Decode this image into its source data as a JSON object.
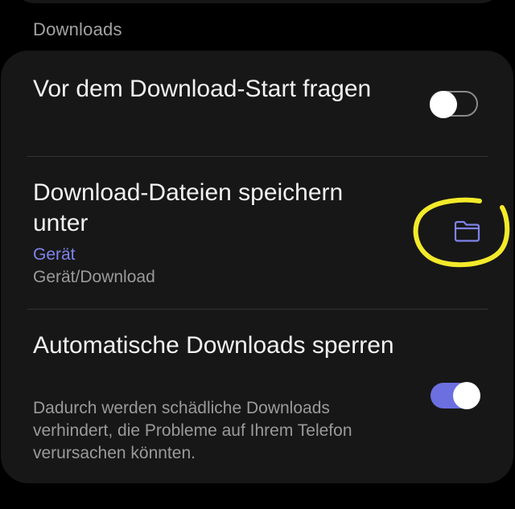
{
  "section": {
    "title": "Downloads"
  },
  "settings": [
    {
      "title": "Vor dem Download-Start fragen",
      "toggle_state": "off"
    },
    {
      "title": "Download-Dateien speichern unter",
      "location": "Gerät",
      "path": "Gerät/Download",
      "icon": "folder-icon"
    },
    {
      "title": "Automatische Downloads sperren",
      "description": "Dadurch werden schädliche Downloads verhindert, die Probleme auf Ihrem Telefon verursachen könnten.",
      "toggle_state": "on"
    }
  ],
  "colors": {
    "background": "#000000",
    "card": "#171717",
    "accent": "#6c6fe0",
    "location_text": "#7f83ea",
    "annotation": "#f3ea2a"
  }
}
